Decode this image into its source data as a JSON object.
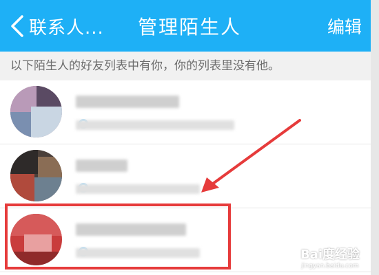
{
  "header": {
    "back_label": "联系人...",
    "title": "管理陌生人",
    "edit_label": "编辑",
    "background_color": "#1eb0f6"
  },
  "notice": {
    "text": "以下陌生人的好友列表中有你，你的列表里没有他。"
  },
  "contacts": [
    {
      "name": "",
      "detail": "",
      "blurred": true
    },
    {
      "name": "",
      "detail": "",
      "blurred": true
    },
    {
      "name": "",
      "detail": "",
      "blurred": true,
      "highlighted": true
    }
  ],
  "annotation": {
    "highlight_color": "#e63b3b",
    "arrow_color": "#e63b3b"
  },
  "watermark": {
    "brand": "Bai度经验",
    "url": "jingyan.baidu.com"
  }
}
